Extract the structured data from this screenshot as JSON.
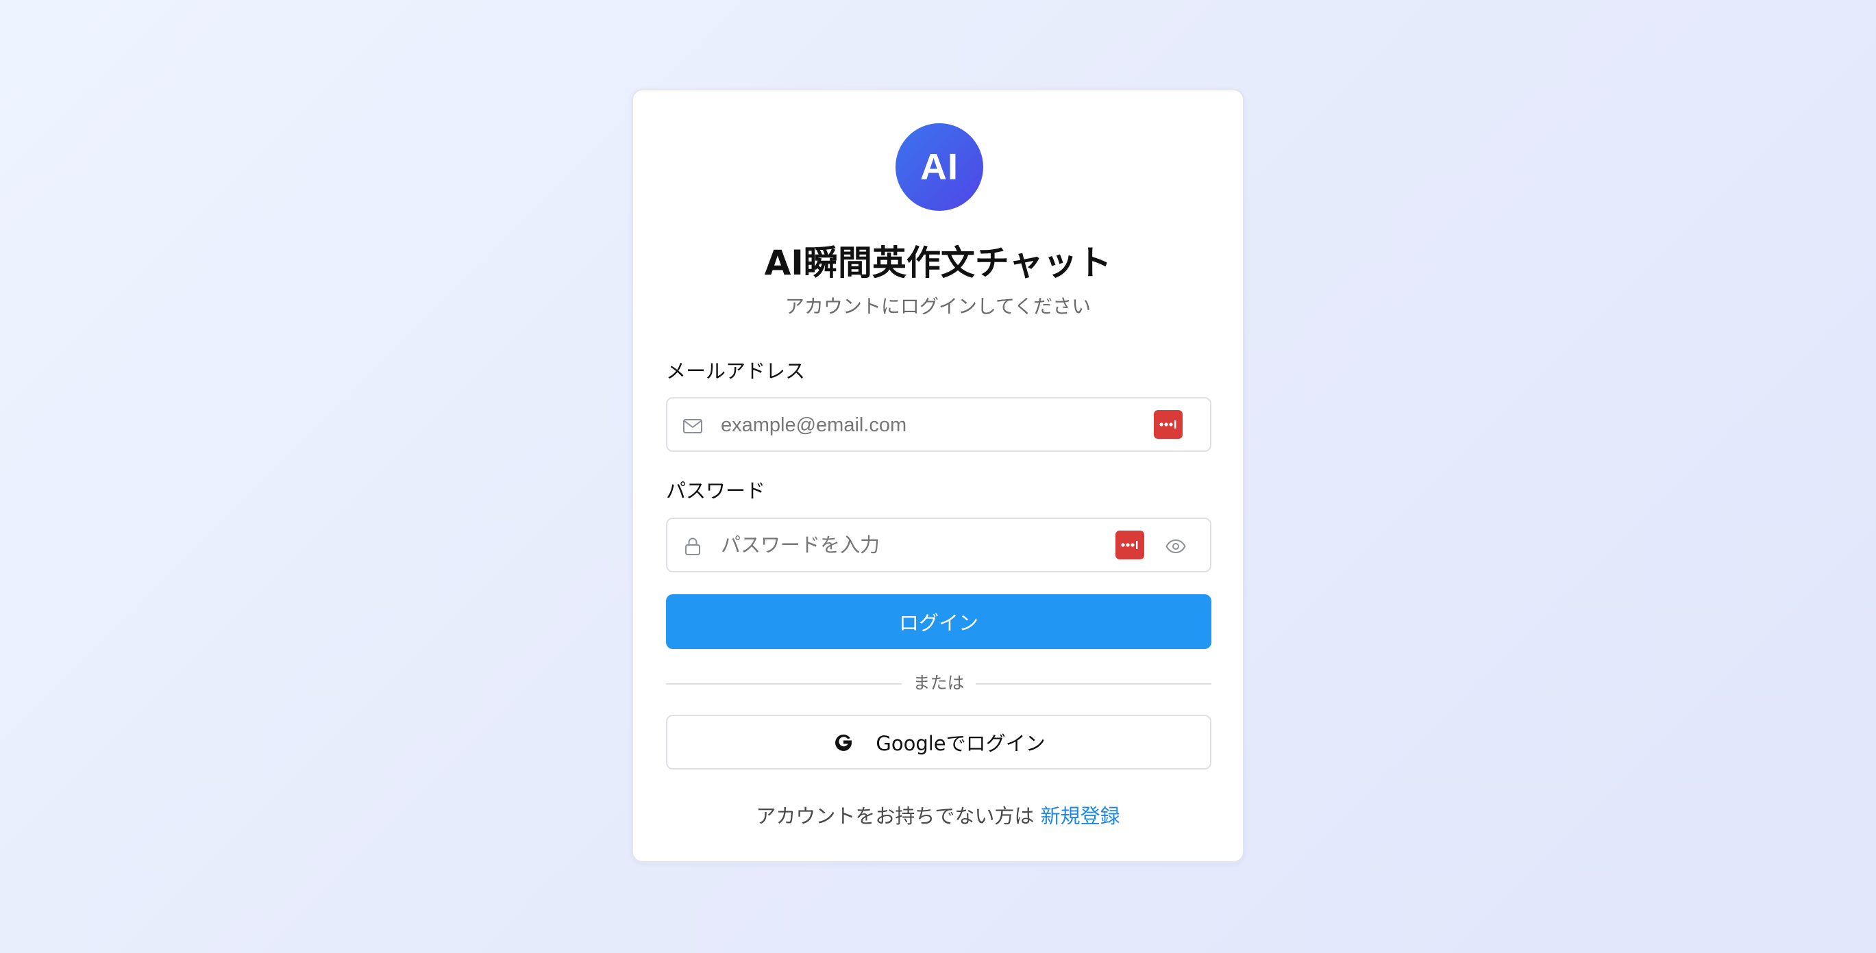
{
  "app": {
    "logo_text": "AI",
    "title": "AI瞬間英作文チャット",
    "subtitle": "アカウントにログインしてください"
  },
  "form": {
    "email_label": "メールアドレス",
    "email_placeholder": "example@email.com",
    "email_value": "",
    "password_label": "パスワード",
    "password_placeholder": "パスワードを入力",
    "password_value": "",
    "login_button": "ログイン",
    "divider_text": "または",
    "google_button": "Googleでログイン"
  },
  "footer": {
    "prompt": "アカウントをお持ちでない方は",
    "signup_link": "新規登録"
  },
  "icons": {
    "email": "mail-icon",
    "password": "lock-icon",
    "password_manager": "password-manager-icon",
    "toggle_visibility": "eye-icon",
    "google": "google-icon"
  },
  "colors": {
    "primary": "#2196f3",
    "logo_gradient_start": "#3b74ee",
    "logo_gradient_end": "#4f46e5",
    "password_manager_badge": "#d93b38",
    "link": "#1e88e5"
  }
}
